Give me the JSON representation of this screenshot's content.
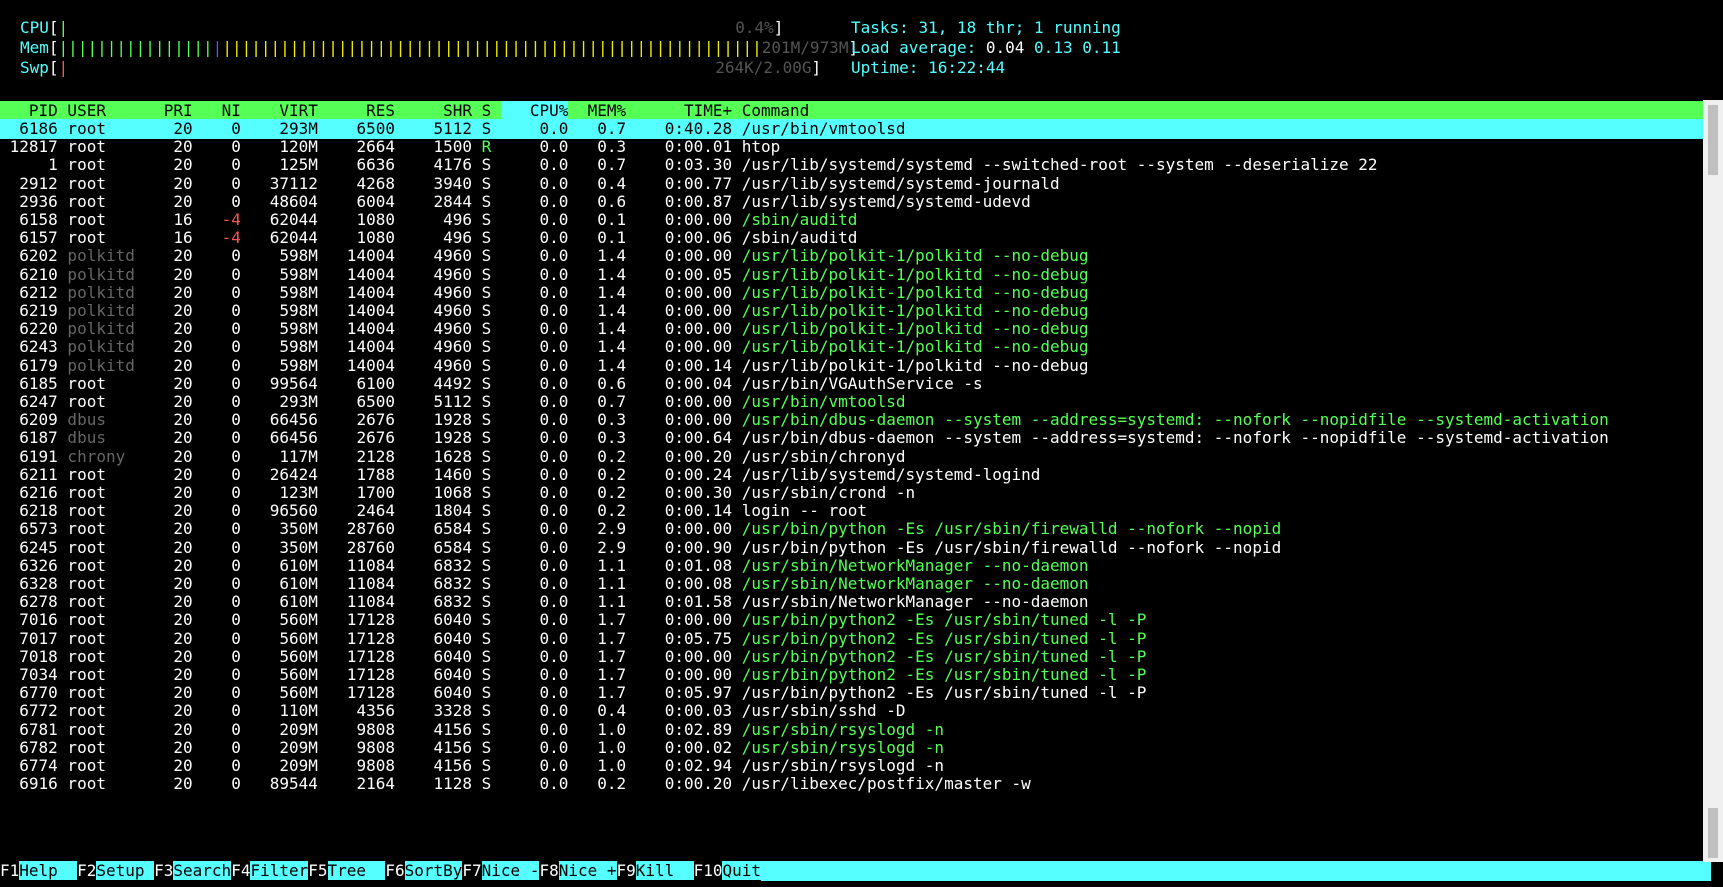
{
  "meters": {
    "cpu": {
      "label": "CPU",
      "value": "0.4%"
    },
    "mem": {
      "label": "Mem",
      "value": "201M/973M"
    },
    "swp": {
      "label": "Swp",
      "value": "264K/2.00G"
    }
  },
  "summary": {
    "tasks_label": "Tasks:",
    "tasks_value": "31, 18 thr; 1 running",
    "load_label": "Load average:",
    "load1": "0.04",
    "load5": "0.13",
    "load15": "0.11",
    "uptime_label": "Uptime:",
    "uptime_value": "16:22:44"
  },
  "columns": [
    "PID",
    "USER",
    "PRI",
    "NI",
    "VIRT",
    "RES",
    "SHR",
    "S",
    "CPU%",
    "MEM%",
    "TIME+",
    "Command"
  ],
  "sort_column": "CPU%",
  "processes": [
    [
      "6186",
      "root",
      "20",
      "0",
      "293M",
      "6500",
      "5112",
      "S",
      "0.0",
      "0.7",
      "0:40.28",
      "/usr/bin/vmtoolsd"
    ],
    [
      "12817",
      "root",
      "20",
      "0",
      "120M",
      "2664",
      "1500",
      "R",
      "0.0",
      "0.3",
      "0:00.01",
      "htop"
    ],
    [
      "1",
      "root",
      "20",
      "0",
      "125M",
      "6636",
      "4176",
      "S",
      "0.0",
      "0.7",
      "0:03.30",
      "/usr/lib/systemd/systemd --switched-root --system --deserialize 22"
    ],
    [
      "2912",
      "root",
      "20",
      "0",
      "37112",
      "4268",
      "3940",
      "S",
      "0.0",
      "0.4",
      "0:00.77",
      "/usr/lib/systemd/systemd-journald"
    ],
    [
      "2936",
      "root",
      "20",
      "0",
      "48604",
      "6004",
      "2844",
      "S",
      "0.0",
      "0.6",
      "0:00.87",
      "/usr/lib/systemd/systemd-udevd"
    ],
    [
      "6158",
      "root",
      "16",
      "-4",
      "62044",
      "1080",
      "496",
      "S",
      "0.0",
      "0.1",
      "0:00.00",
      "/sbin/auditd"
    ],
    [
      "6157",
      "root",
      "16",
      "-4",
      "62044",
      "1080",
      "496",
      "S",
      "0.0",
      "0.1",
      "0:00.06",
      "/sbin/auditd"
    ],
    [
      "6202",
      "polkitd",
      "20",
      "0",
      "598M",
      "14004",
      "4960",
      "S",
      "0.0",
      "1.4",
      "0:00.00",
      "/usr/lib/polkit-1/polkitd --no-debug"
    ],
    [
      "6210",
      "polkitd",
      "20",
      "0",
      "598M",
      "14004",
      "4960",
      "S",
      "0.0",
      "1.4",
      "0:00.05",
      "/usr/lib/polkit-1/polkitd --no-debug"
    ],
    [
      "6212",
      "polkitd",
      "20",
      "0",
      "598M",
      "14004",
      "4960",
      "S",
      "0.0",
      "1.4",
      "0:00.00",
      "/usr/lib/polkit-1/polkitd --no-debug"
    ],
    [
      "6219",
      "polkitd",
      "20",
      "0",
      "598M",
      "14004",
      "4960",
      "S",
      "0.0",
      "1.4",
      "0:00.00",
      "/usr/lib/polkit-1/polkitd --no-debug"
    ],
    [
      "6220",
      "polkitd",
      "20",
      "0",
      "598M",
      "14004",
      "4960",
      "S",
      "0.0",
      "1.4",
      "0:00.00",
      "/usr/lib/polkit-1/polkitd --no-debug"
    ],
    [
      "6243",
      "polkitd",
      "20",
      "0",
      "598M",
      "14004",
      "4960",
      "S",
      "0.0",
      "1.4",
      "0:00.00",
      "/usr/lib/polkit-1/polkitd --no-debug"
    ],
    [
      "6179",
      "polkitd",
      "20",
      "0",
      "598M",
      "14004",
      "4960",
      "S",
      "0.0",
      "1.4",
      "0:00.14",
      "/usr/lib/polkit-1/polkitd --no-debug"
    ],
    [
      "6185",
      "root",
      "20",
      "0",
      "99564",
      "6100",
      "4492",
      "S",
      "0.0",
      "0.6",
      "0:00.04",
      "/usr/bin/VGAuthService -s"
    ],
    [
      "6247",
      "root",
      "20",
      "0",
      "293M",
      "6500",
      "5112",
      "S",
      "0.0",
      "0.7",
      "0:00.00",
      "/usr/bin/vmtoolsd"
    ],
    [
      "6209",
      "dbus",
      "20",
      "0",
      "66456",
      "2676",
      "1928",
      "S",
      "0.0",
      "0.3",
      "0:00.00",
      "/usr/bin/dbus-daemon --system --address=systemd: --nofork --nopidfile --systemd-activation"
    ],
    [
      "6187",
      "dbus",
      "20",
      "0",
      "66456",
      "2676",
      "1928",
      "S",
      "0.0",
      "0.3",
      "0:00.64",
      "/usr/bin/dbus-daemon --system --address=systemd: --nofork --nopidfile --systemd-activation"
    ],
    [
      "6191",
      "chrony",
      "20",
      "0",
      "117M",
      "2128",
      "1628",
      "S",
      "0.0",
      "0.2",
      "0:00.20",
      "/usr/sbin/chronyd"
    ],
    [
      "6211",
      "root",
      "20",
      "0",
      "26424",
      "1788",
      "1460",
      "S",
      "0.0",
      "0.2",
      "0:00.24",
      "/usr/lib/systemd/systemd-logind"
    ],
    [
      "6216",
      "root",
      "20",
      "0",
      "123M",
      "1700",
      "1068",
      "S",
      "0.0",
      "0.2",
      "0:00.30",
      "/usr/sbin/crond -n"
    ],
    [
      "6218",
      "root",
      "20",
      "0",
      "96560",
      "2464",
      "1804",
      "S",
      "0.0",
      "0.2",
      "0:00.14",
      "login -- root"
    ],
    [
      "6573",
      "root",
      "20",
      "0",
      "350M",
      "28760",
      "6584",
      "S",
      "0.0",
      "2.9",
      "0:00.00",
      "/usr/bin/python -Es /usr/sbin/firewalld --nofork --nopid"
    ],
    [
      "6245",
      "root",
      "20",
      "0",
      "350M",
      "28760",
      "6584",
      "S",
      "0.0",
      "2.9",
      "0:00.90",
      "/usr/bin/python -Es /usr/sbin/firewalld --nofork --nopid"
    ],
    [
      "6326",
      "root",
      "20",
      "0",
      "610M",
      "11084",
      "6832",
      "S",
      "0.0",
      "1.1",
      "0:01.08",
      "/usr/sbin/NetworkManager --no-daemon"
    ],
    [
      "6328",
      "root",
      "20",
      "0",
      "610M",
      "11084",
      "6832",
      "S",
      "0.0",
      "1.1",
      "0:00.08",
      "/usr/sbin/NetworkManager --no-daemon"
    ],
    [
      "6278",
      "root",
      "20",
      "0",
      "610M",
      "11084",
      "6832",
      "S",
      "0.0",
      "1.1",
      "0:01.58",
      "/usr/sbin/NetworkManager --no-daemon"
    ],
    [
      "7016",
      "root",
      "20",
      "0",
      "560M",
      "17128",
      "6040",
      "S",
      "0.0",
      "1.7",
      "0:00.00",
      "/usr/bin/python2 -Es /usr/sbin/tuned -l -P"
    ],
    [
      "7017",
      "root",
      "20",
      "0",
      "560M",
      "17128",
      "6040",
      "S",
      "0.0",
      "1.7",
      "0:05.75",
      "/usr/bin/python2 -Es /usr/sbin/tuned -l -P"
    ],
    [
      "7018",
      "root",
      "20",
      "0",
      "560M",
      "17128",
      "6040",
      "S",
      "0.0",
      "1.7",
      "0:00.00",
      "/usr/bin/python2 -Es /usr/sbin/tuned -l -P"
    ],
    [
      "7034",
      "root",
      "20",
      "0",
      "560M",
      "17128",
      "6040",
      "S",
      "0.0",
      "1.7",
      "0:00.00",
      "/usr/bin/python2 -Es /usr/sbin/tuned -l -P"
    ],
    [
      "6770",
      "root",
      "20",
      "0",
      "560M",
      "17128",
      "6040",
      "S",
      "0.0",
      "1.7",
      "0:05.97",
      "/usr/bin/python2 -Es /usr/sbin/tuned -l -P"
    ],
    [
      "6772",
      "root",
      "20",
      "0",
      "110M",
      "4356",
      "3328",
      "S",
      "0.0",
      "0.4",
      "0:00.03",
      "/usr/sbin/sshd -D"
    ],
    [
      "6781",
      "root",
      "20",
      "0",
      "209M",
      "9808",
      "4156",
      "S",
      "0.0",
      "1.0",
      "0:02.89",
      "/usr/sbin/rsyslogd -n"
    ],
    [
      "6782",
      "root",
      "20",
      "0",
      "209M",
      "9808",
      "4156",
      "S",
      "0.0",
      "1.0",
      "0:00.02",
      "/usr/sbin/rsyslogd -n"
    ],
    [
      "6774",
      "root",
      "20",
      "0",
      "209M",
      "9808",
      "4156",
      "S",
      "0.0",
      "1.0",
      "0:02.94",
      "/usr/sbin/rsyslogd -n"
    ],
    [
      "6916",
      "root",
      "20",
      "0",
      "89544",
      "2164",
      "1128",
      "S",
      "0.0",
      "0.2",
      "0:00.20",
      "/usr/libexec/postfix/master -w"
    ]
  ],
  "thread_rows": [
    0,
    5,
    7,
    8,
    9,
    10,
    11,
    12,
    15,
    16,
    22,
    24,
    25,
    27,
    28,
    29,
    30,
    33,
    34
  ],
  "selected_row": 0,
  "footer": [
    {
      "key": "F1",
      "label": "Help  "
    },
    {
      "key": "F2",
      "label": "Setup "
    },
    {
      "key": "F3",
      "label": "Search"
    },
    {
      "key": "F4",
      "label": "Filter"
    },
    {
      "key": "F5",
      "label": "Tree  "
    },
    {
      "key": "F6",
      "label": "SortBy"
    },
    {
      "key": "F7",
      "label": "Nice -"
    },
    {
      "key": "F8",
      "label": "Nice +"
    },
    {
      "key": "F9",
      "label": "Kill  "
    },
    {
      "key": "F10",
      "label": "Quit"
    }
  ],
  "colors": {
    "cyan": "#55ffff",
    "green": "#55ff55",
    "red": "#ff5555",
    "grey": "#666666"
  }
}
